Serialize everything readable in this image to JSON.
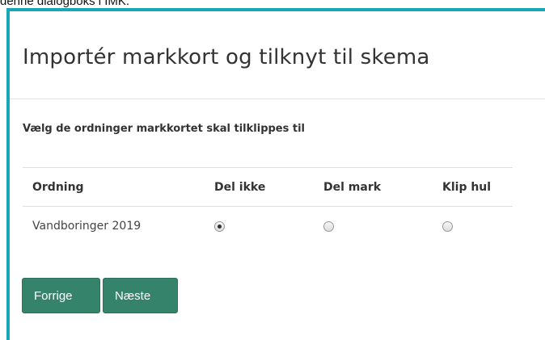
{
  "caption": "denne dialogboks i IMK.",
  "dialog": {
    "title": "Importér markkort og tilknyt til skema",
    "subheading": "Vælg de ordninger markkortet skal tilklippes til",
    "table": {
      "headers": [
        "Ordning",
        "Del ikke",
        "Del mark",
        "Klip hul"
      ],
      "rows": [
        {
          "ordning": "Vandboringer 2019",
          "selected": "Del ikke"
        }
      ]
    },
    "buttons": {
      "back_label": "Forrige",
      "next_label": "Næste"
    }
  },
  "colors": {
    "dialog_accent": "#1aa6b7",
    "button_bg": "#35836b"
  }
}
